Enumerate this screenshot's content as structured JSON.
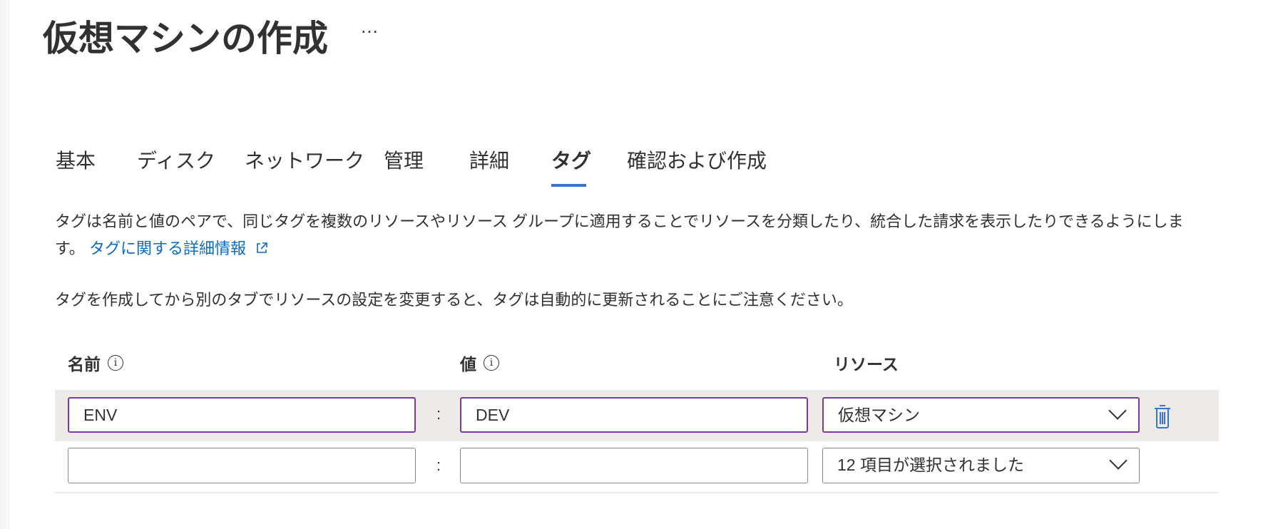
{
  "header": {
    "title": "仮想マシンの作成",
    "more_label": "…"
  },
  "tabs": [
    {
      "label": "基本"
    },
    {
      "label": "ディスク"
    },
    {
      "label": "ネットワーク"
    },
    {
      "label": "管理"
    },
    {
      "label": "詳細"
    },
    {
      "label": "タグ",
      "active": true
    },
    {
      "label": "確認および作成"
    }
  ],
  "description": {
    "text": "タグは名前と値のペアで、同じタグを複数のリソースやリソース グループに適用することでリソースを分類したり、統合した請求を表示したりできるようにします。",
    "link": "タグに関する詳細情報",
    "note": "タグを作成してから別のタブでリソースの設定を変更すると、タグは自動的に更新されることにご注意ください。"
  },
  "columns": {
    "name": "名前",
    "value": "値",
    "resource": "リソース",
    "info_icon": "ⓘ"
  },
  "rows": [
    {
      "name": "ENV",
      "separator": ":",
      "value": "DEV",
      "resource": "仮想マシン"
    },
    {
      "name": "",
      "separator": ":",
      "value": "",
      "resource": "12 項目が選択されました"
    }
  ],
  "colors": {
    "accent": "#3b73cf",
    "focus_border": "#8035a8",
    "link": "#0f6cbd"
  }
}
